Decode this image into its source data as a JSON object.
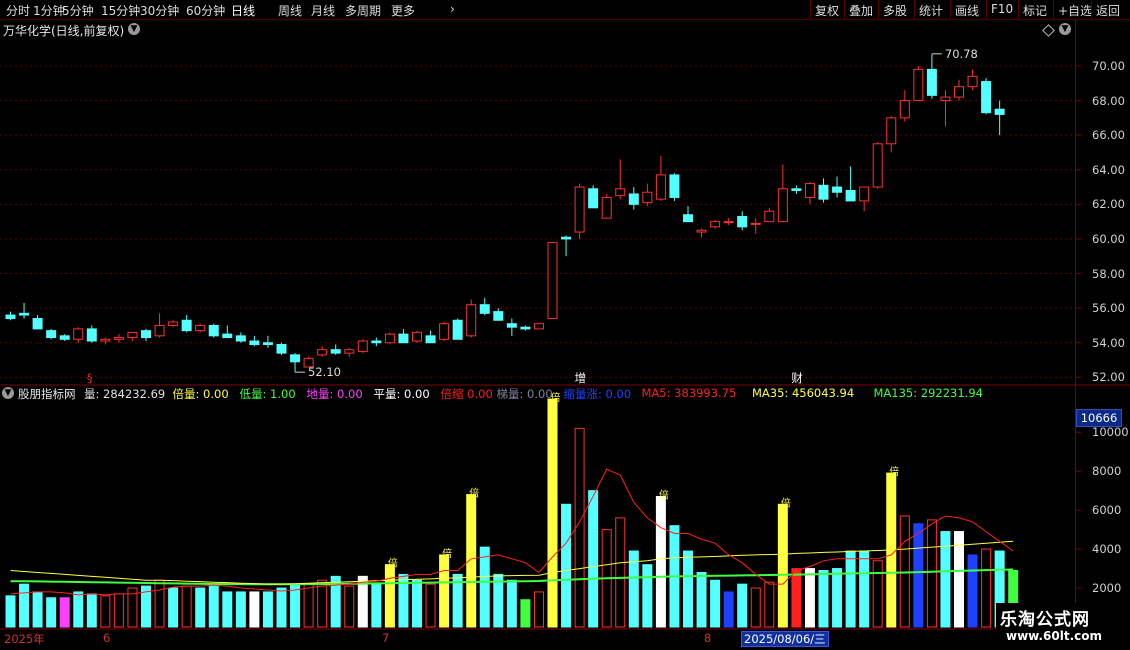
{
  "toolbar": {
    "left": [
      "分时",
      "1分钟",
      "5分钟",
      "15分钟",
      "30分钟",
      "60分钟",
      "日线",
      "周线",
      "月线",
      "多周期",
      "更多"
    ],
    "active": "日线",
    "right": [
      "复权",
      "叠加",
      "多股",
      "统计",
      "画线",
      "F10",
      "标记",
      "+自选",
      "返回"
    ]
  },
  "stock": {
    "title": "万华化学(日线,前复权)"
  },
  "price_axis": {
    "labels": [
      "70.00",
      "68.00",
      "66.00",
      "64.00",
      "62.00",
      "60.00",
      "58.00",
      "56.00",
      "54.00",
      "52.00"
    ]
  },
  "price_annotations": {
    "high": "70.78",
    "low": "52.10"
  },
  "events": [
    {
      "label": "§",
      "color": "#e03030"
    },
    {
      "label": "增",
      "color": "#ffffff"
    },
    {
      "label": "财",
      "color": "#ffffff"
    }
  ],
  "indicator": {
    "name": "股朋指标网",
    "items": [
      {
        "label": "量:",
        "value": "284232.69",
        "color": "#e0e0e0"
      },
      {
        "label": "倍量:",
        "value": "0.00",
        "color": "#ffff40"
      },
      {
        "label": "低量:",
        "value": "1.00",
        "color": "#40ff40"
      },
      {
        "label": "地量:",
        "value": "0.00",
        "color": "#ff40ff"
      },
      {
        "label": "平量:",
        "value": "0.00",
        "color": "#ffffff"
      },
      {
        "label": "倍缩",
        "value": "0.00",
        "color": "#ff2020"
      },
      {
        "label": "梯量:",
        "value": "0.00",
        "color": "#8080a0"
      },
      {
        "label": "缩量涨:",
        "value": "0.00",
        "color": "#2040ff"
      },
      {
        "label": "MA5:",
        "value": "383993.75",
        "color": "#ff2020"
      },
      {
        "label": "MA35:",
        "value": "456043.94",
        "color": "#ffff40"
      },
      {
        "label": "MA135:",
        "value": "292231.94",
        "color": "#40ff40"
      }
    ],
    "bei_marker": "倍"
  },
  "volume_axis": {
    "badge": "10666",
    "labels": [
      "10000",
      "8000",
      "6000",
      "4000",
      "2000"
    ]
  },
  "date_axis": {
    "labels": [
      "2025年",
      "6",
      "7",
      "8"
    ],
    "selected": "2025/08/06/三"
  },
  "watermark": {
    "name": "乐淘公式网",
    "url": "www.60lt.com"
  },
  "colors": {
    "up": "#ff3030",
    "down": "#54ffff",
    "grid": "#5a0000",
    "axis": "#800000"
  },
  "chart_data": {
    "type": "candlestick",
    "price_range": [
      51.5,
      71.5
    ],
    "volume_range": [
      0,
      11500
    ],
    "candles": [
      {
        "o": 55.6,
        "h": 55.8,
        "l": 55.3,
        "c": 55.4
      },
      {
        "o": 55.7,
        "h": 56.3,
        "l": 55.4,
        "c": 55.6
      },
      {
        "o": 55.4,
        "h": 55.6,
        "l": 54.9,
        "c": 54.8
      },
      {
        "o": 54.7,
        "h": 54.8,
        "l": 54.2,
        "c": 54.3
      },
      {
        "o": 54.4,
        "h": 54.5,
        "l": 54.1,
        "c": 54.2
      },
      {
        "o": 54.2,
        "h": 54.9,
        "l": 54.0,
        "c": 54.8
      },
      {
        "o": 54.8,
        "h": 55.0,
        "l": 54.0,
        "c": 54.1
      },
      {
        "o": 54.1,
        "h": 54.3,
        "l": 53.9,
        "c": 54.2
      },
      {
        "o": 54.2,
        "h": 54.5,
        "l": 54.0,
        "c": 54.3
      },
      {
        "o": 54.3,
        "h": 54.6,
        "l": 54.1,
        "c": 54.6
      },
      {
        "o": 54.7,
        "h": 54.8,
        "l": 54.1,
        "c": 54.3
      },
      {
        "o": 54.4,
        "h": 55.7,
        "l": 54.3,
        "c": 55.0
      },
      {
        "o": 55.0,
        "h": 55.3,
        "l": 54.9,
        "c": 55.2
      },
      {
        "o": 55.3,
        "h": 55.6,
        "l": 54.6,
        "c": 54.7
      },
      {
        "o": 54.7,
        "h": 55.1,
        "l": 54.6,
        "c": 55.0
      },
      {
        "o": 55.0,
        "h": 55.1,
        "l": 54.3,
        "c": 54.4
      },
      {
        "o": 54.5,
        "h": 55.0,
        "l": 54.3,
        "c": 54.3
      },
      {
        "o": 54.4,
        "h": 54.6,
        "l": 54.0,
        "c": 54.1
      },
      {
        "o": 54.1,
        "h": 54.4,
        "l": 53.8,
        "c": 53.9
      },
      {
        "o": 54.0,
        "h": 54.4,
        "l": 53.7,
        "c": 53.9
      },
      {
        "o": 53.9,
        "h": 54.0,
        "l": 53.3,
        "c": 53.4
      },
      {
        "o": 53.3,
        "h": 53.4,
        "l": 52.3,
        "c": 52.9
      },
      {
        "o": 52.6,
        "h": 53.2,
        "l": 52.6,
        "c": 53.1
      },
      {
        "o": 53.3,
        "h": 53.8,
        "l": 53.2,
        "c": 53.6
      },
      {
        "o": 53.6,
        "h": 53.9,
        "l": 53.3,
        "c": 53.4
      },
      {
        "o": 53.4,
        "h": 53.7,
        "l": 53.2,
        "c": 53.6
      },
      {
        "o": 53.5,
        "h": 54.2,
        "l": 53.4,
        "c": 54.1
      },
      {
        "o": 54.1,
        "h": 54.3,
        "l": 53.8,
        "c": 54.0
      },
      {
        "o": 54.0,
        "h": 54.6,
        "l": 53.9,
        "c": 54.5
      },
      {
        "o": 54.5,
        "h": 54.8,
        "l": 54.0,
        "c": 54.0
      },
      {
        "o": 54.1,
        "h": 54.7,
        "l": 54.0,
        "c": 54.6
      },
      {
        "o": 54.4,
        "h": 54.7,
        "l": 54.0,
        "c": 54.0
      },
      {
        "o": 54.2,
        "h": 55.2,
        "l": 54.1,
        "c": 55.1
      },
      {
        "o": 55.3,
        "h": 55.4,
        "l": 54.2,
        "c": 54.2
      },
      {
        "o": 54.4,
        "h": 56.5,
        "l": 54.3,
        "c": 56.2
      },
      {
        "o": 56.2,
        "h": 56.6,
        "l": 55.6,
        "c": 55.7
      },
      {
        "o": 55.8,
        "h": 56.0,
        "l": 55.3,
        "c": 55.3
      },
      {
        "o": 55.1,
        "h": 55.4,
        "l": 54.4,
        "c": 54.9
      },
      {
        "o": 54.9,
        "h": 55.0,
        "l": 54.7,
        "c": 54.8
      },
      {
        "o": 54.8,
        "h": 55.1,
        "l": 54.8,
        "c": 55.1
      },
      {
        "o": 55.4,
        "h": 59.8,
        "l": 55.4,
        "c": 59.8
      },
      {
        "o": 60.1,
        "h": 60.2,
        "l": 59.0,
        "c": 60.0
      },
      {
        "o": 60.4,
        "h": 63.2,
        "l": 60.0,
        "c": 63.0
      },
      {
        "o": 62.9,
        "h": 63.1,
        "l": 61.8,
        "c": 61.8
      },
      {
        "o": 61.2,
        "h": 62.6,
        "l": 61.2,
        "c": 62.4
      },
      {
        "o": 62.5,
        "h": 64.6,
        "l": 62.3,
        "c": 62.9
      },
      {
        "o": 62.6,
        "h": 63.0,
        "l": 61.7,
        "c": 62.0
      },
      {
        "o": 62.1,
        "h": 63.2,
        "l": 61.9,
        "c": 62.7
      },
      {
        "o": 62.3,
        "h": 64.8,
        "l": 62.2,
        "c": 63.7
      },
      {
        "o": 63.7,
        "h": 63.8,
        "l": 62.2,
        "c": 62.4
      },
      {
        "o": 61.4,
        "h": 61.9,
        "l": 61.0,
        "c": 61.0
      },
      {
        "o": 60.4,
        "h": 60.6,
        "l": 60.1,
        "c": 60.5
      },
      {
        "o": 60.7,
        "h": 61.1,
        "l": 60.6,
        "c": 61.0
      },
      {
        "o": 61.0,
        "h": 61.2,
        "l": 60.8,
        "c": 61.0
      },
      {
        "o": 61.3,
        "h": 61.6,
        "l": 60.5,
        "c": 60.7
      },
      {
        "o": 60.9,
        "h": 61.2,
        "l": 60.3,
        "c": 60.9
      },
      {
        "o": 61.0,
        "h": 61.8,
        "l": 61.0,
        "c": 61.6
      },
      {
        "o": 61.0,
        "h": 64.3,
        "l": 61.0,
        "c": 62.9
      },
      {
        "o": 62.9,
        "h": 63.1,
        "l": 62.6,
        "c": 62.8
      },
      {
        "o": 62.4,
        "h": 63.3,
        "l": 62.0,
        "c": 63.2
      },
      {
        "o": 63.1,
        "h": 63.5,
        "l": 62.1,
        "c": 62.3
      },
      {
        "o": 63.0,
        "h": 63.6,
        "l": 62.4,
        "c": 62.7
      },
      {
        "o": 62.8,
        "h": 64.2,
        "l": 62.2,
        "c": 62.2
      },
      {
        "o": 62.2,
        "h": 63.0,
        "l": 61.6,
        "c": 63.0
      },
      {
        "o": 63.0,
        "h": 65.6,
        "l": 62.9,
        "c": 65.5
      },
      {
        "o": 65.5,
        "h": 67.1,
        "l": 65.0,
        "c": 67.0
      },
      {
        "o": 67.0,
        "h": 68.6,
        "l": 66.8,
        "c": 68.0
      },
      {
        "o": 68.0,
        "h": 70.0,
        "l": 68.0,
        "c": 69.8
      },
      {
        "o": 69.8,
        "h": 70.7,
        "l": 68.1,
        "c": 68.3
      },
      {
        "o": 68.0,
        "h": 68.6,
        "l": 66.5,
        "c": 68.2
      },
      {
        "o": 68.2,
        "h": 69.2,
        "l": 68.0,
        "c": 68.8
      },
      {
        "o": 68.8,
        "h": 69.8,
        "l": 68.6,
        "c": 69.4
      },
      {
        "o": 69.1,
        "h": 69.3,
        "l": 67.2,
        "c": 67.3
      },
      {
        "o": 67.5,
        "h": 68.0,
        "l": 66.0,
        "c": 67.2
      }
    ],
    "volumes": [
      {
        "v": 1600,
        "c": "u"
      },
      {
        "v": 2200,
        "c": "u"
      },
      {
        "v": 1800,
        "c": "c"
      },
      {
        "v": 1500,
        "c": "c"
      },
      {
        "v": 1500,
        "c": "m"
      },
      {
        "v": 1800,
        "c": "u"
      },
      {
        "v": 1700,
        "c": "c"
      },
      {
        "v": 1600,
        "c": "r"
      },
      {
        "v": 1700,
        "c": "r"
      },
      {
        "v": 2000,
        "c": "r"
      },
      {
        "v": 2100,
        "c": "c"
      },
      {
        "v": 2400,
        "c": "r"
      },
      {
        "v": 2000,
        "c": "c"
      },
      {
        "v": 2100,
        "c": "r"
      },
      {
        "v": 2000,
        "c": "c"
      },
      {
        "v": 2200,
        "c": "c"
      },
      {
        "v": 1800,
        "c": "c"
      },
      {
        "v": 1800,
        "c": "c"
      },
      {
        "v": 1800,
        "c": "w"
      },
      {
        "v": 1800,
        "c": "c"
      },
      {
        "v": 2000,
        "c": "c"
      },
      {
        "v": 2200,
        "c": "c"
      },
      {
        "v": 2200,
        "c": "r"
      },
      {
        "v": 2400,
        "c": "r"
      },
      {
        "v": 2600,
        "c": "c"
      },
      {
        "v": 2100,
        "c": "r"
      },
      {
        "v": 2600,
        "c": "w"
      },
      {
        "v": 2200,
        "c": "c"
      },
      {
        "v": 3200,
        "c": "y",
        "b": 1
      },
      {
        "v": 2700,
        "c": "c"
      },
      {
        "v": 2400,
        "c": "c"
      },
      {
        "v": 2200,
        "c": "r"
      },
      {
        "v": 3700,
        "c": "y",
        "b": 1
      },
      {
        "v": 2700,
        "c": "c"
      },
      {
        "v": 6800,
        "c": "y",
        "b": 1
      },
      {
        "v": 4100,
        "c": "c"
      },
      {
        "v": 2700,
        "c": "c"
      },
      {
        "v": 2400,
        "c": "c"
      },
      {
        "v": 1400,
        "c": "g"
      },
      {
        "v": 1800,
        "c": "r"
      },
      {
        "v": 11700,
        "c": "y",
        "b": 1
      },
      {
        "v": 6300,
        "c": "c"
      },
      {
        "v": 10200,
        "c": "r"
      },
      {
        "v": 7000,
        "c": "c"
      },
      {
        "v": 5000,
        "c": "r"
      },
      {
        "v": 5600,
        "c": "r"
      },
      {
        "v": 3900,
        "c": "c"
      },
      {
        "v": 3200,
        "c": "c"
      },
      {
        "v": 6700,
        "c": "w",
        "b": 1
      },
      {
        "v": 5200,
        "c": "c"
      },
      {
        "v": 3900,
        "c": "c"
      },
      {
        "v": 2800,
        "c": "c"
      },
      {
        "v": 2400,
        "c": "c"
      },
      {
        "v": 1800,
        "c": "b"
      },
      {
        "v": 2200,
        "c": "c"
      },
      {
        "v": 2000,
        "c": "r"
      },
      {
        "v": 2300,
        "c": "r"
      },
      {
        "v": 6300,
        "c": "y",
        "b": 1
      },
      {
        "v": 3000,
        "c": "rf"
      },
      {
        "v": 3000,
        "c": "w"
      },
      {
        "v": 2900,
        "c": "c"
      },
      {
        "v": 3000,
        "c": "c"
      },
      {
        "v": 3900,
        "c": "c"
      },
      {
        "v": 3900,
        "c": "c"
      },
      {
        "v": 3400,
        "c": "r"
      },
      {
        "v": 7900,
        "c": "y",
        "b": 1
      },
      {
        "v": 5700,
        "c": "r"
      },
      {
        "v": 5300,
        "c": "b"
      },
      {
        "v": 5500,
        "c": "r"
      },
      {
        "v": 4900,
        "c": "c"
      },
      {
        "v": 4900,
        "c": "w"
      },
      {
        "v": 3700,
        "c": "b"
      },
      {
        "v": 4000,
        "c": "r"
      },
      {
        "v": 3900,
        "c": "c"
      },
      {
        "v": 2900,
        "c": "g"
      }
    ],
    "ma5": [
      1700,
      1750,
      1800,
      1800,
      1750,
      1650,
      1700,
      1650,
      1700,
      1700,
      1800,
      1900,
      2050,
      2100,
      2100,
      2150,
      2100,
      2000,
      1950,
      1900,
      1850,
      1900,
      2000,
      2100,
      2150,
      2200,
      2300,
      2350,
      2500,
      2600,
      2700,
      2700,
      2900,
      2900,
      3500,
      3600,
      3700,
      3500,
      3300,
      2800,
      3600,
      4300,
      5400,
      6700,
      8100,
      7800,
      6400,
      5600,
      5100,
      4800,
      4800,
      4500,
      4300,
      3700,
      3300,
      2700,
      2200,
      2200,
      2900,
      3100,
      3400,
      3500,
      3500,
      3500,
      3500,
      3700,
      4400,
      4800,
      5300,
      5700,
      5600,
      5400,
      4900,
      4400,
      3900
    ],
    "ma35": [
      2900,
      2850,
      2800,
      2750,
      2700,
      2650,
      2600,
      2550,
      2500,
      2450,
      2400,
      2400,
      2380,
      2350,
      2330,
      2300,
      2280,
      2250,
      2230,
      2200,
      2200,
      2220,
      2250,
      2280,
      2300,
      2320,
      2350,
      2370,
      2400,
      2430,
      2450,
      2470,
      2500,
      2520,
      2560,
      2600,
      2620,
      2640,
      2650,
      2660,
      2800,
      2900,
      3000,
      3100,
      3200,
      3300,
      3350,
      3400,
      3500,
      3550,
      3580,
      3600,
      3620,
      3650,
      3680,
      3700,
      3720,
      3740,
      3780,
      3800,
      3830,
      3850,
      3880,
      3900,
      3930,
      3960,
      4000,
      4050,
      4100,
      4150,
      4200,
      4250,
      4300,
      4350,
      4400
    ],
    "ma135": [
      2350,
      2350,
      2340,
      2330,
      2320,
      2310,
      2300,
      2290,
      2280,
      2270,
      2260,
      2250,
      2240,
      2230,
      2220,
      2210,
      2200,
      2200,
      2190,
      2190,
      2190,
      2190,
      2200,
      2200,
      2210,
      2220,
      2230,
      2240,
      2250,
      2260,
      2270,
      2280,
      2290,
      2300,
      2310,
      2320,
      2330,
      2340,
      2350,
      2360,
      2400,
      2420,
      2450,
      2480,
      2500,
      2520,
      2540,
      2560,
      2580,
      2600,
      2610,
      2620,
      2630,
      2640,
      2650,
      2660,
      2670,
      2680,
      2690,
      2700,
      2720,
      2730,
      2750,
      2760,
      2770,
      2790,
      2800,
      2820,
      2840,
      2860,
      2880,
      2900,
      2920,
      2940,
      2950
    ]
  }
}
